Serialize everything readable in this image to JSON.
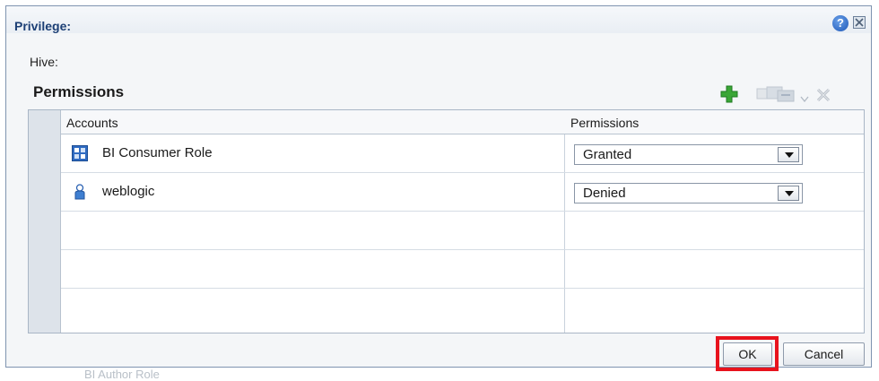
{
  "background": {
    "ghost_text": "BI Author Role"
  },
  "dialog": {
    "title": "Privilege:",
    "help_symbol": "?",
    "hive_label": "Hive:",
    "section_title": "Permissions"
  },
  "toolbar": {
    "icons": [
      "add-icon",
      "edit-icon",
      "dropdown-arrow-icon",
      "delete-icon"
    ]
  },
  "table": {
    "columns": [
      "Accounts",
      "Permissions"
    ],
    "rows": [
      {
        "account": "BI Consumer Role",
        "icon": "role-icon",
        "permission": "Granted"
      },
      {
        "account": "weblogic",
        "icon": "user-icon",
        "permission": "Denied"
      }
    ],
    "empty_rows": 3
  },
  "footer": {
    "ok_label": "OK",
    "cancel_label": "Cancel"
  },
  "colors": {
    "title": "#1c3f75",
    "highlight": "#e8131d",
    "add_green": "#3aa636"
  }
}
